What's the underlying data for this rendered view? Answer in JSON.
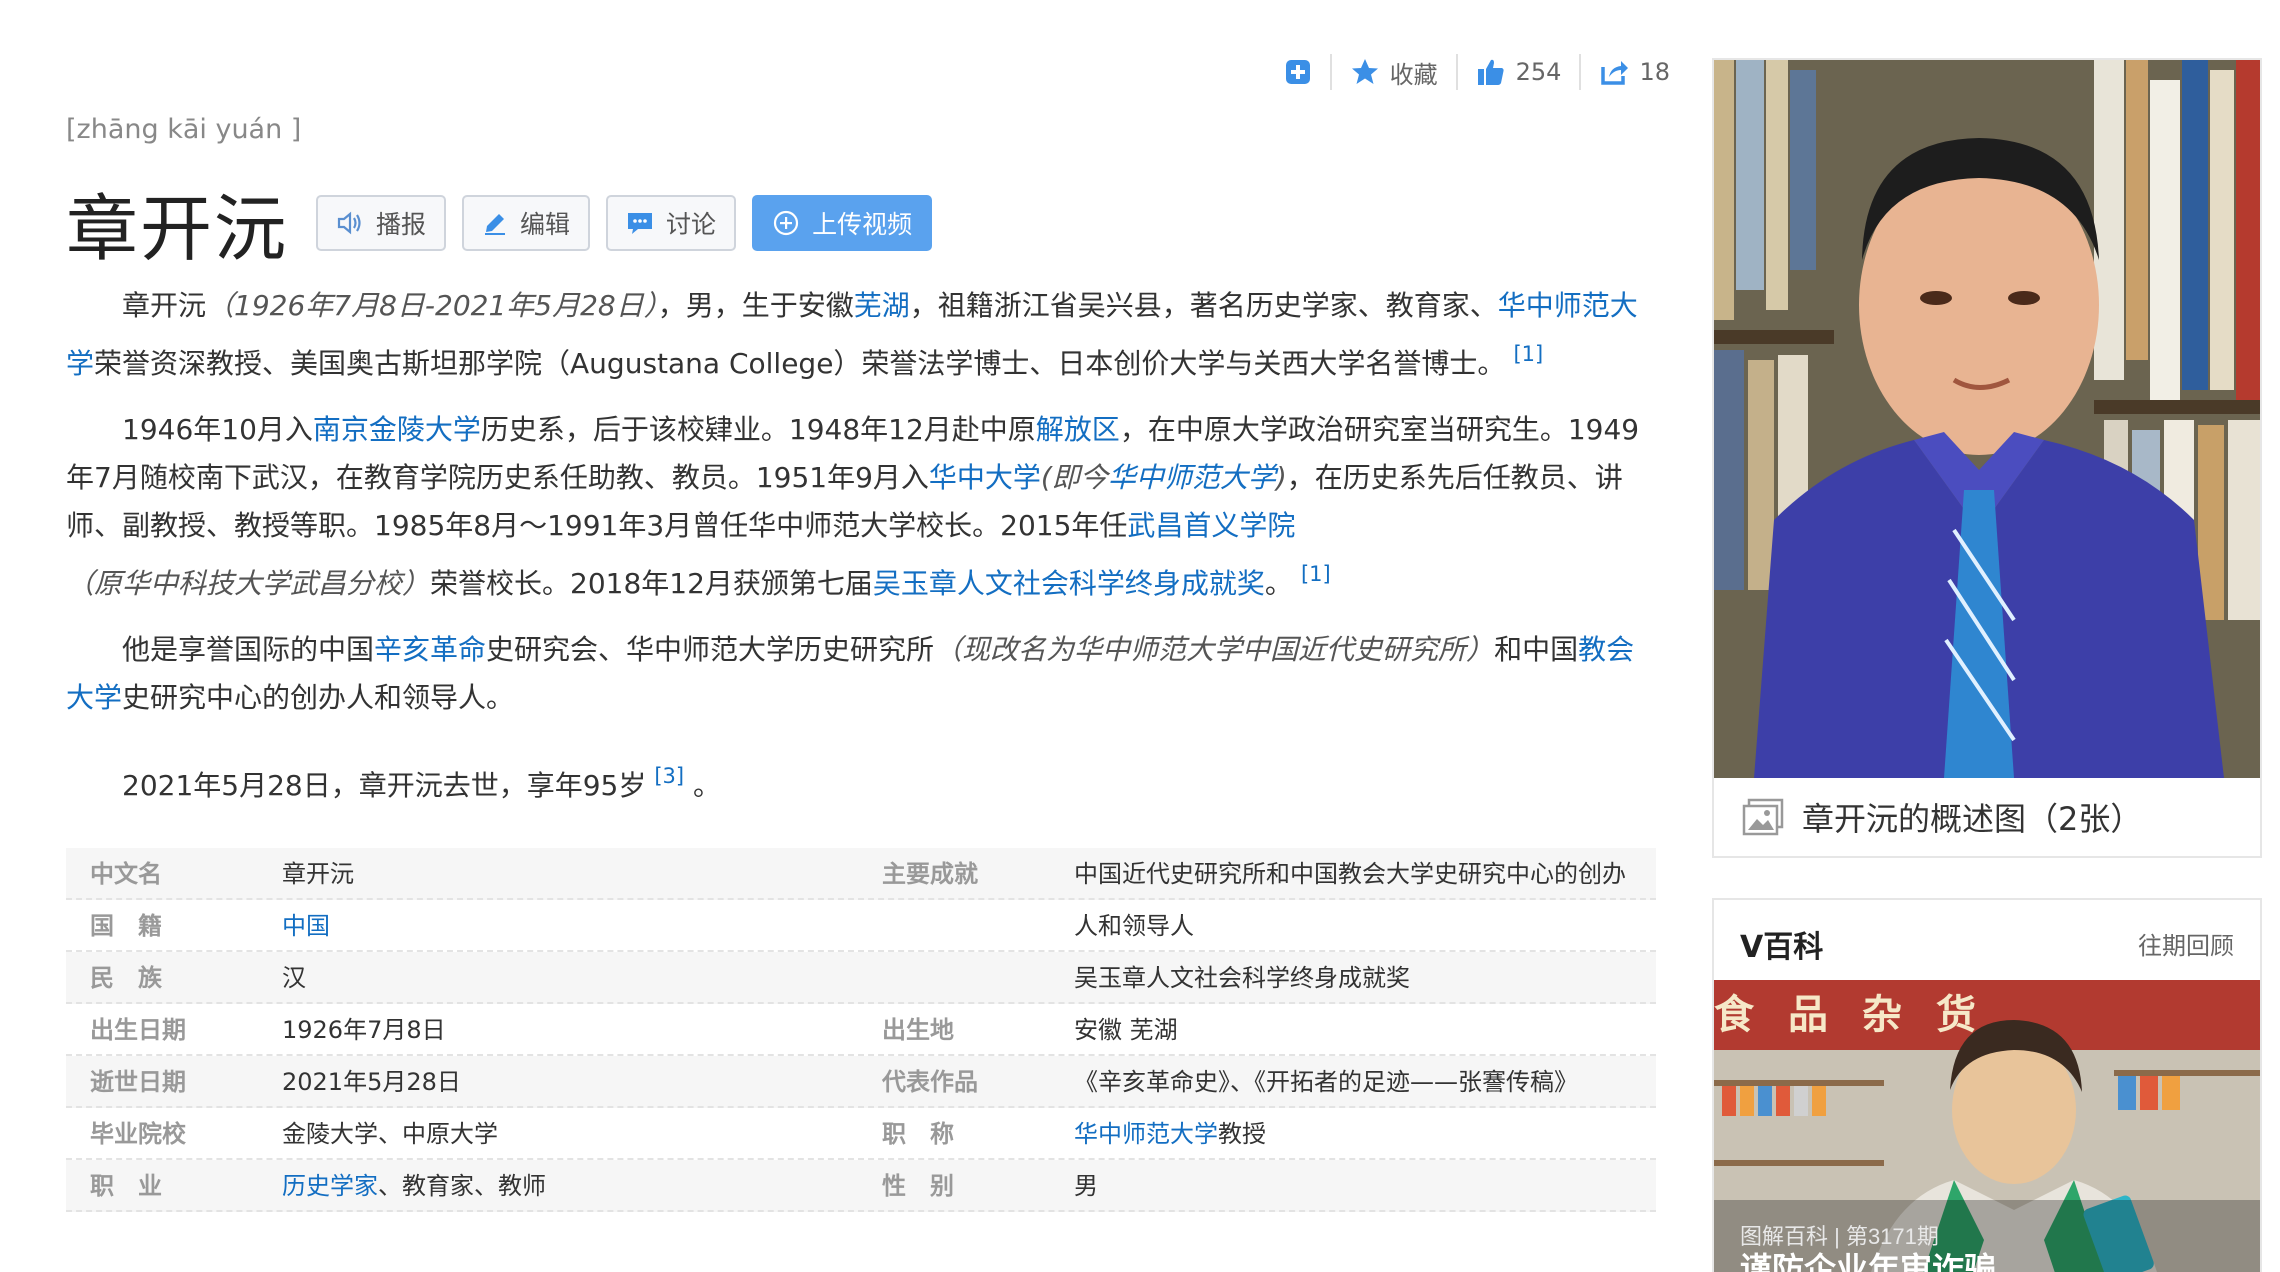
{
  "actions": {
    "favorite_label": "收藏",
    "like_count": "254",
    "share_count": "18"
  },
  "entry": {
    "pinyin": "[zhāng kāi yuán ]",
    "title": "章开沅",
    "buttons": [
      "播报",
      "编辑",
      "讨论",
      "上传视频"
    ]
  },
  "paragraphs": {
    "p1": [
      {
        "t": "章开沅"
      },
      {
        "t": "（1926年7月8日-2021年5月28日）",
        "i": true
      },
      {
        "t": "，男，生于安徽"
      },
      {
        "t": "芜湖",
        "link": true
      },
      {
        "t": "，祖籍浙江省吴兴县，著名历史学家、教育家、"
      },
      {
        "t": "华中师范大学",
        "link": true
      },
      {
        "t": "荣誉资深教授、美国奥古斯坦那学院（Augustana College）荣誉法学博士、日本创价大学与关西大学名誉博士。"
      },
      {
        "t": "[1]",
        "sup": true
      }
    ],
    "p2": [
      {
        "t": "1946年10月入"
      },
      {
        "t": "南京金陵大学",
        "link": true
      },
      {
        "t": "历史系，后于该校肄业。1948年12月赴中原"
      },
      {
        "t": "解放区",
        "link": true
      },
      {
        "t": "，在中原大学政治研究室当研究生。1949年7月随校南下武汉，在教育学院历史系任助教、教员。1951年9月入"
      },
      {
        "t": "华中大学",
        "link": true
      },
      {
        "t": "(即今",
        "i": true
      },
      {
        "t": "华中师范大学",
        "link": true,
        "i": true
      },
      {
        "t": ")",
        "i": true
      },
      {
        "t": "，在历史系先后任教员、讲师、副教授、教授等职。1985年8月～1991年3月曾任华中师范大学校长。2015年任"
      },
      {
        "t": "武昌首义学院",
        "link": true
      },
      {
        "t": "（原华中科技大学武昌分校）",
        "i": true
      },
      {
        "t": "荣誉校长。2018年12月获颁第七届"
      },
      {
        "t": "吴玉章人文社会科学终身成就奖",
        "link": true
      },
      {
        "t": "。"
      },
      {
        "t": "[1]",
        "sup": true
      }
    ],
    "p3": [
      {
        "t": "他是享誉国际的中国"
      },
      {
        "t": "辛亥革命",
        "link": true
      },
      {
        "t": "史研究会、华中师范大学历史研究所"
      },
      {
        "t": "（现改名为华中师范大学中国近代史研究所）",
        "i": true
      },
      {
        "t": "和中国"
      },
      {
        "t": "教会大学",
        "link": true
      },
      {
        "t": "史研究中心的创办人和领导人。"
      }
    ],
    "p4": [
      {
        "t": "2021年5月28日，章开沅去世，享年95岁"
      },
      {
        "t": "[3]",
        "sup": true
      },
      {
        "t": " 。"
      }
    ]
  },
  "infobox": [
    {
      "k1": "中文名",
      "v1": [
        {
          "t": "章开沅"
        }
      ],
      "k2": "主要成就",
      "v2": [
        {
          "t": "中国近代史研究所和中国教会大学史研究中心的创办"
        }
      ]
    },
    {
      "k1": "国　籍",
      "v1": [
        {
          "t": "中国",
          "link": true
        }
      ],
      "k2": "",
      "v2": [
        {
          "t": "人和领导人"
        }
      ]
    },
    {
      "k1": "民　族",
      "v1": [
        {
          "t": "汉"
        }
      ],
      "k2": "",
      "v2": [
        {
          "t": "吴玉章人文社会科学终身成就奖"
        }
      ]
    },
    {
      "k1": "出生日期",
      "v1": [
        {
          "t": "1926年7月8日"
        }
      ],
      "k2": "出生地",
      "v2": [
        {
          "t": "安徽 芜湖"
        }
      ]
    },
    {
      "k1": "逝世日期",
      "v1": [
        {
          "t": "2021年5月28日"
        }
      ],
      "k2": "代表作品",
      "v2": [
        {
          "t": "《辛亥革命史》、《开拓者的足迹——张謇传稿》"
        }
      ]
    },
    {
      "k1": "毕业院校",
      "v1": [
        {
          "t": "金陵大学、中原大学"
        }
      ],
      "k2": "职　称",
      "v2": [
        {
          "t": "华中师范大学",
          "link": true
        },
        {
          "t": "教授"
        }
      ]
    },
    {
      "k1": "职　业",
      "v1": [
        {
          "t": "历史学家",
          "link": true
        },
        {
          "t": "、教育家、教师"
        }
      ],
      "k2": "性　别",
      "v2": [
        {
          "t": "男"
        }
      ]
    }
  ],
  "side": {
    "album_caption": "章开沅的概述图（2张）",
    "vbaike_title": "V百科",
    "vbaike_more": "往期回顾",
    "video_sign": "食品杂货",
    "video_series": "图解百科 | 第3171期",
    "video_title": "谨防企业年审诈骗"
  },
  "colors": {
    "link": "#136ec2",
    "primary_button": "#5aa2ee",
    "icon_blue": "#3b8fe6"
  },
  "icons": [
    "add-icon",
    "star-icon",
    "thumbs-up-icon",
    "share-icon",
    "speaker-icon",
    "pencil-icon",
    "chat-icon",
    "plus-circle-icon",
    "image-album-icon"
  ]
}
